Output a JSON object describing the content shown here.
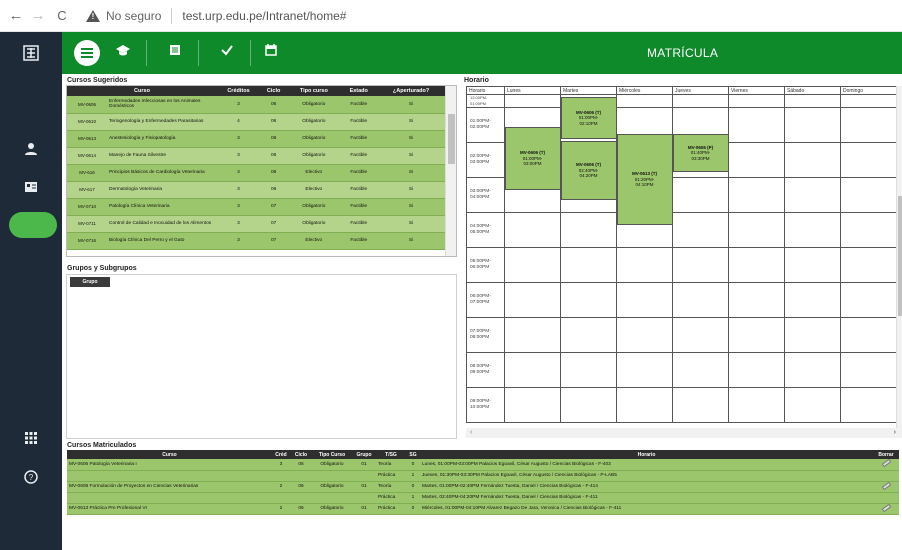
{
  "browser": {
    "back": "←",
    "forward": "→",
    "reload": "C",
    "security_text": "No seguro",
    "url": "test.urp.edu.pe/Intranet/home#"
  },
  "topbar": {
    "title": "MATRÍCULA",
    "icons": [
      "menu-icon",
      "graduation-cap-icon",
      "book-icon",
      "check-icon",
      "calendar-icon"
    ]
  },
  "sidebar": {
    "icons": [
      "university-logo-icon",
      "user-icon",
      "id-card-icon",
      "apps-grid-icon",
      "help-icon"
    ]
  },
  "sugeridos": {
    "title": "Cursos Sugeridos",
    "headers": [
      "Curso",
      "",
      "Créditos",
      "Ciclo",
      "Tipo curso",
      "Estado",
      "¿Aperturado?"
    ],
    "rows": [
      [
        "MV-0606",
        "Enfermedades Infecciosas en los Animales Domésticos",
        "3",
        "06",
        "Obligatorio",
        "Factible",
        "Si"
      ],
      [
        "MV-0610",
        "Teriogenología y Enfermedades Parasitarias",
        "4",
        "06",
        "Obligatorio",
        "Factible",
        "Si"
      ],
      [
        "MV-0613",
        "Anestesiología y Fisiopatología",
        "3",
        "06",
        "Obligatorio",
        "Factible",
        "Si"
      ],
      [
        "MV-0614",
        "Manejo de Fauna Silvestre",
        "3",
        "06",
        "Obligatorio",
        "Factible",
        "Si"
      ],
      [
        "MV-616",
        "Principios Básicos de Cardiología Veterinaria",
        "3",
        "06",
        "Electivo",
        "Factible",
        "Si"
      ],
      [
        "MV-617",
        "Dermatología Veterinaria",
        "3",
        "06",
        "Electivo",
        "Factible",
        "Si"
      ],
      [
        "MV-0710",
        "Patología Clínica Veterinaria",
        "3",
        "07",
        "Obligatorio",
        "Factible",
        "Si"
      ],
      [
        "MV-0711",
        "Control de Calidad e Inocuidad de los Alimentos",
        "3",
        "07",
        "Obligatorio",
        "Factible",
        "Si"
      ],
      [
        "MV-0716",
        "Biología Clínica Del Perro y el Gato",
        "3",
        "07",
        "Electivo",
        "Factible",
        "Si"
      ]
    ]
  },
  "grupos": {
    "title": "Grupos y Subgrupos",
    "tag": "Grupo"
  },
  "horario": {
    "title": "Horario",
    "headers": [
      "Horario",
      "Lunes",
      "Martes",
      "Miércoles",
      "Jueves",
      "Viernes",
      "Sábado",
      "Domingo"
    ],
    "times": [
      "01:00PM-\n02:00PM",
      "02:00PM-\n03:00PM",
      "03:00PM-\n04:00PM",
      "04:00PM-\n05:00PM",
      "05:00PM-\n06:00PM",
      "06:00PM-\n07:00PM",
      "07:00PM-\n08:00PM",
      "08:00PM-\n09:00PM",
      "09:00PM-\n10:00PM"
    ],
    "first_time_partial": "12:00PM-\n01:00PM",
    "blocks": [
      {
        "code": "MV-0606 (T)",
        "time": "01:00PM-\n03:00PM"
      },
      {
        "code": "MV-0606 (T)",
        "time": "01:00PM-\n02:10PM"
      },
      {
        "code": "MV-0606 (T)",
        "time": "02:40PM-\n04:20PM"
      },
      {
        "code": "MV-0613 (T)",
        "time": "01:20PM-\n04:10PM"
      },
      {
        "code": "MV-0606 (P)",
        "time": "01:40PM-\n03:30PM"
      }
    ]
  },
  "matriculados": {
    "title": "Cursos Matriculados",
    "headers": [
      "Curso",
      "Créd",
      "Ciclo",
      "Tipo Curso",
      "Grupo",
      "T/SG",
      "SG",
      "Horario",
      "Borrar"
    ],
    "rows": [
      {
        "curso": "MV-0606 Patología Veterinaria I",
        "cred": "3",
        "ciclo": "06",
        "tipo": "Obligatorio",
        "grupo": "01",
        "tsg": "Teoría",
        "sg": "0",
        "horario": "Lunes, 01:00PM-03:00PM Palacios Egoavil, César Augusto / Ciencias Biológicas - F-403"
      },
      {
        "curso": "",
        "cred": "",
        "ciclo": "",
        "tipo": "",
        "grupo": "",
        "tsg": "Práctica",
        "sg": "1",
        "horario": "Jueves, 01:30PM-03:30PM Palacios Egoavil, César Augusto / Ciencias Biológicas - P-LAB5"
      },
      {
        "curso": "MV-0608 Formulación de Proyectos en Ciencias Veterinarias",
        "cred": "2",
        "ciclo": "06",
        "tipo": "Obligatorio",
        "grupo": "01",
        "tsg": "Teoría",
        "sg": "0",
        "horario": "Martes, 01:00PM-02:40PM Fernández Tuesta, Daniel / Ciencias Biológicas - F-414"
      },
      {
        "curso": "",
        "cred": "",
        "ciclo": "",
        "tipo": "",
        "grupo": "",
        "tsg": "Práctica",
        "sg": "1",
        "horario": "Martes, 02:40PM-04:20PM Fernández Tuesta, Daniel / Ciencias Biológicas - F-411"
      },
      {
        "curso": "MV-0613 Práctica Pre Profesional VI",
        "cred": "2",
        "ciclo": "06",
        "tipo": "Obligatorio",
        "grupo": "01",
        "tsg": "Práctica",
        "sg": "0",
        "horario": "Miércoles, 01:00PM-04:10PM Alvarez Begazo De Jara, Veronica / Ciencias Biológicas - F-411"
      }
    ]
  }
}
